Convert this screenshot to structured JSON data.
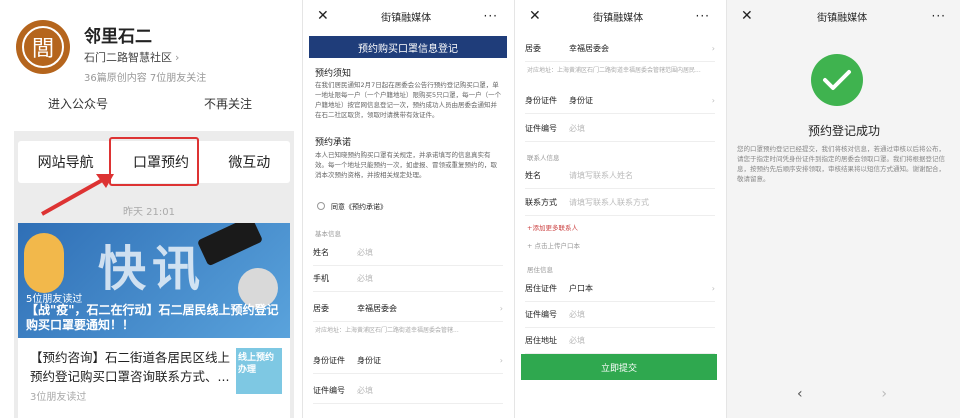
{
  "account": {
    "logo_char": "閭",
    "name": "邻里石二",
    "subtitle": "石门二路智慧社区",
    "stats": "36篇原创内容  7位朋友关注",
    "actions": [
      "进入公众号",
      "不再关注"
    ]
  },
  "menu": {
    "items": [
      "网站导航",
      "口罩预约",
      "微互动"
    ],
    "highlight_color": "#d33333"
  },
  "feed": {
    "time": "昨天 21:01",
    "headline_image_text": "快讯",
    "article1_reads": "5位朋友读过",
    "article1_title": "【战\"疫\"，石二在行动】石二居民线上预约登记购买口罩要通知！！",
    "article2_title": "【预约咨询】石二街道各居民区线上预约登记购买口罩咨询联系方式、...",
    "article2_reads": "3位朋友读过",
    "article2_thumb": "线上预约办理"
  },
  "form1": {
    "header_title": "街镇融媒体",
    "banner": "预约购买口罩信息登记",
    "section1_title": "预约须知",
    "section1_text": "在我们居民通知2月7日起在居委会公告行预约登记购买口罩，单一地址限每一户（一个户籍地址）限购买5只口罩，每一户（一个户籍地址）按官网信息登记一次，预约成功人员由居委会通知并在石二社区取货，领取时请携带有效证件。",
    "section2_title": "预约承诺",
    "section2_text": "本人已知晓预约购买口罩有关规定，并承诺填写的信息真实有效。每一个地址只能预约一次，如虚报、冒领或重复预约的，取消本次预约资格，并按相关规定处理。",
    "agree": "同意《预约承诺》",
    "basic_info": "基本信息",
    "fields": [
      {
        "label": "姓名",
        "value": "",
        "placeholder": "必填"
      },
      {
        "label": "手机",
        "value": "",
        "placeholder": "必填"
      },
      {
        "label": "居委",
        "value": "幸福居委会",
        "placeholder": ""
      }
    ],
    "address_note": "对应地址：上海黄浦区石门二路街道幸福居委会管辖...",
    "id_fields": [
      {
        "label": "身份证件",
        "value": "身份证"
      },
      {
        "label": "证件编号",
        "placeholder": "必填"
      }
    ]
  },
  "form2": {
    "header_title": "街镇融媒体",
    "fields": [
      {
        "label": "居委",
        "value": "幸福居委会"
      },
      {
        "label": "身份证件",
        "value": "身份证"
      },
      {
        "label": "证件编号",
        "placeholder": "必填"
      }
    ],
    "address_note": "对应地址：上海黄浦区石门二路街道幸福居委会管辖范围内居民...",
    "contact_section": "联系人信息",
    "contact_fields": [
      {
        "label": "姓名",
        "placeholder": "请填写联系人姓名"
      },
      {
        "label": "联系方式",
        "placeholder": "请填写联系人联系方式"
      }
    ],
    "add_contact": "+添加更多联系人",
    "add_contact_sub": "+ 点击上传户口本",
    "residence_section": "居住信息",
    "residence_fields": [
      {
        "label": "居住证件",
        "value": "户口本"
      },
      {
        "label": "证件编号",
        "placeholder": "必填"
      },
      {
        "label": "居住地址",
        "placeholder": "必填"
      }
    ],
    "submit": "立即提交"
  },
  "success": {
    "header_title": "街镇融媒体",
    "title": "预约登记成功",
    "desc": "您的口罩预约登记已经提交，我们将核对信息，若通过审核以后将公布，请您于指定时间凭身份证件到指定的居委会领取口罩。我们将根据登记信息，按预约先后顺序安排领取，审核结果将以短信方式通知。谢谢配合，敬请留意。",
    "prev": "‹",
    "next": "›",
    "accent": "#3fb34f"
  }
}
